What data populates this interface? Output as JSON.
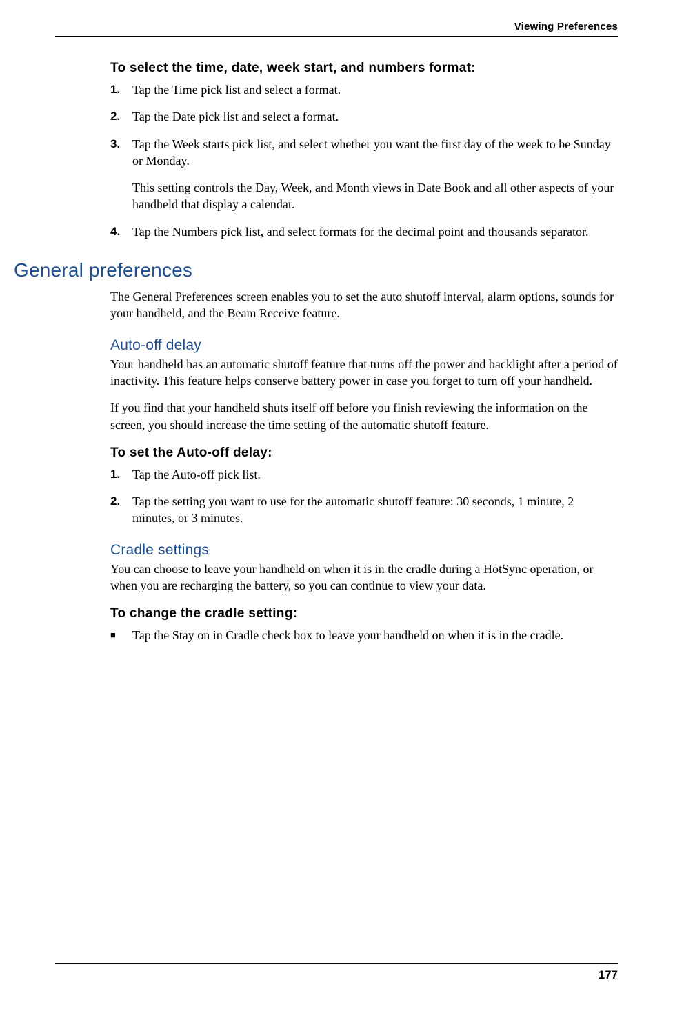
{
  "header": {
    "title": "Viewing Preferences"
  },
  "section1": {
    "heading": "To select the time, date, week start, and numbers format:",
    "items": [
      {
        "num": "1.",
        "text": "Tap the Time pick list and select a format."
      },
      {
        "num": "2.",
        "text": "Tap the Date pick list and select a format."
      },
      {
        "num": "3.",
        "text": "Tap the Week starts pick list, and select whether you want the first day of the week to be Sunday or Monday.",
        "sub": "This setting controls the Day, Week, and Month views in Date Book and all other aspects of your handheld that display a calendar."
      },
      {
        "num": "4.",
        "text": "Tap the Numbers pick list, and select formats for the decimal point and thousands separator."
      }
    ]
  },
  "section2": {
    "heading": "General preferences",
    "intro": "The General Preferences screen enables you to set the auto shutoff interval, alarm options, sounds for your handheld, and the Beam Receive feature."
  },
  "section3": {
    "heading": "Auto-off delay",
    "para1": "Your handheld has an automatic shutoff feature that turns off the power and backlight after a period of inactivity. This feature helps conserve battery power in case you forget to turn off your handheld.",
    "para2": "If you find that your handheld shuts itself off before you finish reviewing the information on the screen, you should increase the time setting of the automatic shutoff feature."
  },
  "section4": {
    "heading": "To set the Auto-off delay:",
    "items": [
      {
        "num": "1.",
        "text": "Tap the Auto-off pick list."
      },
      {
        "num": "2.",
        "text": "Tap the setting you want to use for the automatic shutoff feature: 30 seconds, 1 minute, 2 minutes, or 3 minutes."
      }
    ]
  },
  "section5": {
    "heading": "Cradle settings",
    "para1": "You can choose to leave your handheld on when it is in the cradle during a HotSync operation, or when you are recharging the battery, so you can continue to view your data."
  },
  "section6": {
    "heading": "To change the cradle setting:",
    "bullet": "■",
    "text": "Tap the Stay on in Cradle check box to leave your handheld on when it is in the cradle."
  },
  "footer": {
    "page": "177"
  }
}
